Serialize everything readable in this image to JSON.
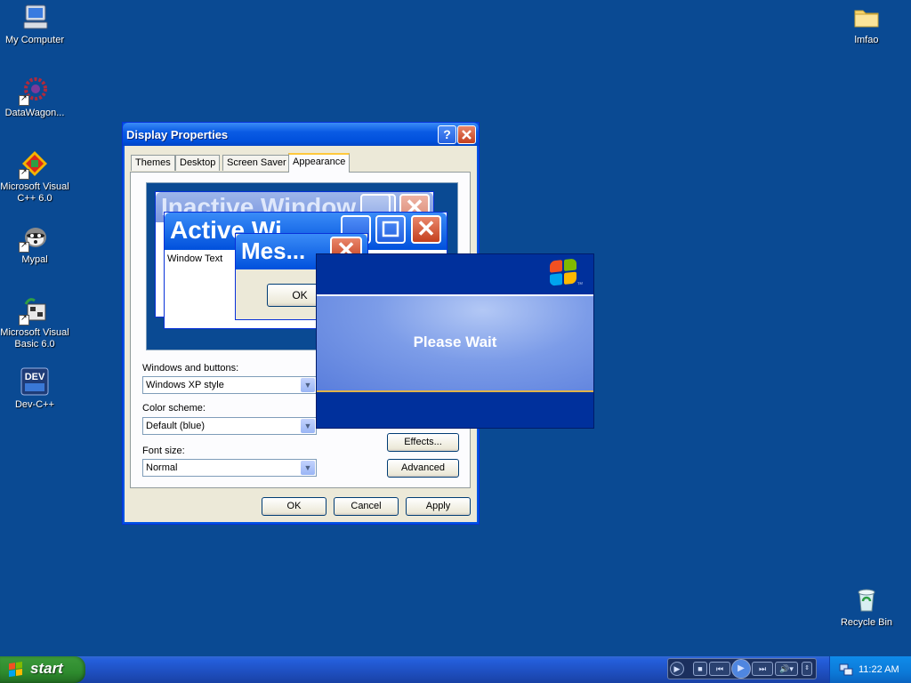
{
  "desktop": {
    "icons": [
      {
        "label": "My Computer",
        "icon": "my-computer-icon"
      },
      {
        "label": "DataWagon...",
        "icon": "datawagon-icon"
      },
      {
        "label": "Microsoft Visual\nC++ 6.0",
        "icon": "visual-cpp-icon"
      },
      {
        "label": "Mypal",
        "icon": "mypal-icon"
      },
      {
        "label": "Microsoft Visual\nBasic 6.0",
        "icon": "visual-basic-icon"
      },
      {
        "label": "Dev-C++",
        "icon": "dev-cpp-icon"
      },
      {
        "label": "lmfao",
        "icon": "folder-icon"
      },
      {
        "label": "Recycle Bin",
        "icon": "recycle-bin-icon"
      }
    ],
    "background_color": "#0a4a93"
  },
  "dialog": {
    "title": "Display Properties",
    "help_label": "?",
    "tabs": [
      "Themes",
      "Desktop",
      "Screen Saver",
      "Appearance"
    ],
    "active_tab": "Appearance",
    "preview": {
      "inactive_title": "Inactive Window",
      "active_title": "Active Wi",
      "window_text": "Window Text",
      "message_title": "Mes...",
      "message_ok": "OK"
    },
    "windows_and_buttons_label": "Windows and buttons:",
    "windows_and_buttons_value": "Windows XP style",
    "color_scheme_label": "Color scheme:",
    "color_scheme_value": "Default (blue)",
    "font_size_label": "Font size:",
    "font_size_value": "Normal",
    "effects_label": "Effects...",
    "advanced_label": "Advanced",
    "ok_label": "OK",
    "cancel_label": "Cancel",
    "apply_label": "Apply"
  },
  "splash": {
    "message": "Please Wait",
    "logo_tm": "TM"
  },
  "taskbar": {
    "start_label": "start",
    "clock": "11:22 AM",
    "accent": "#245edb",
    "start_color": "#2e8b2e"
  }
}
